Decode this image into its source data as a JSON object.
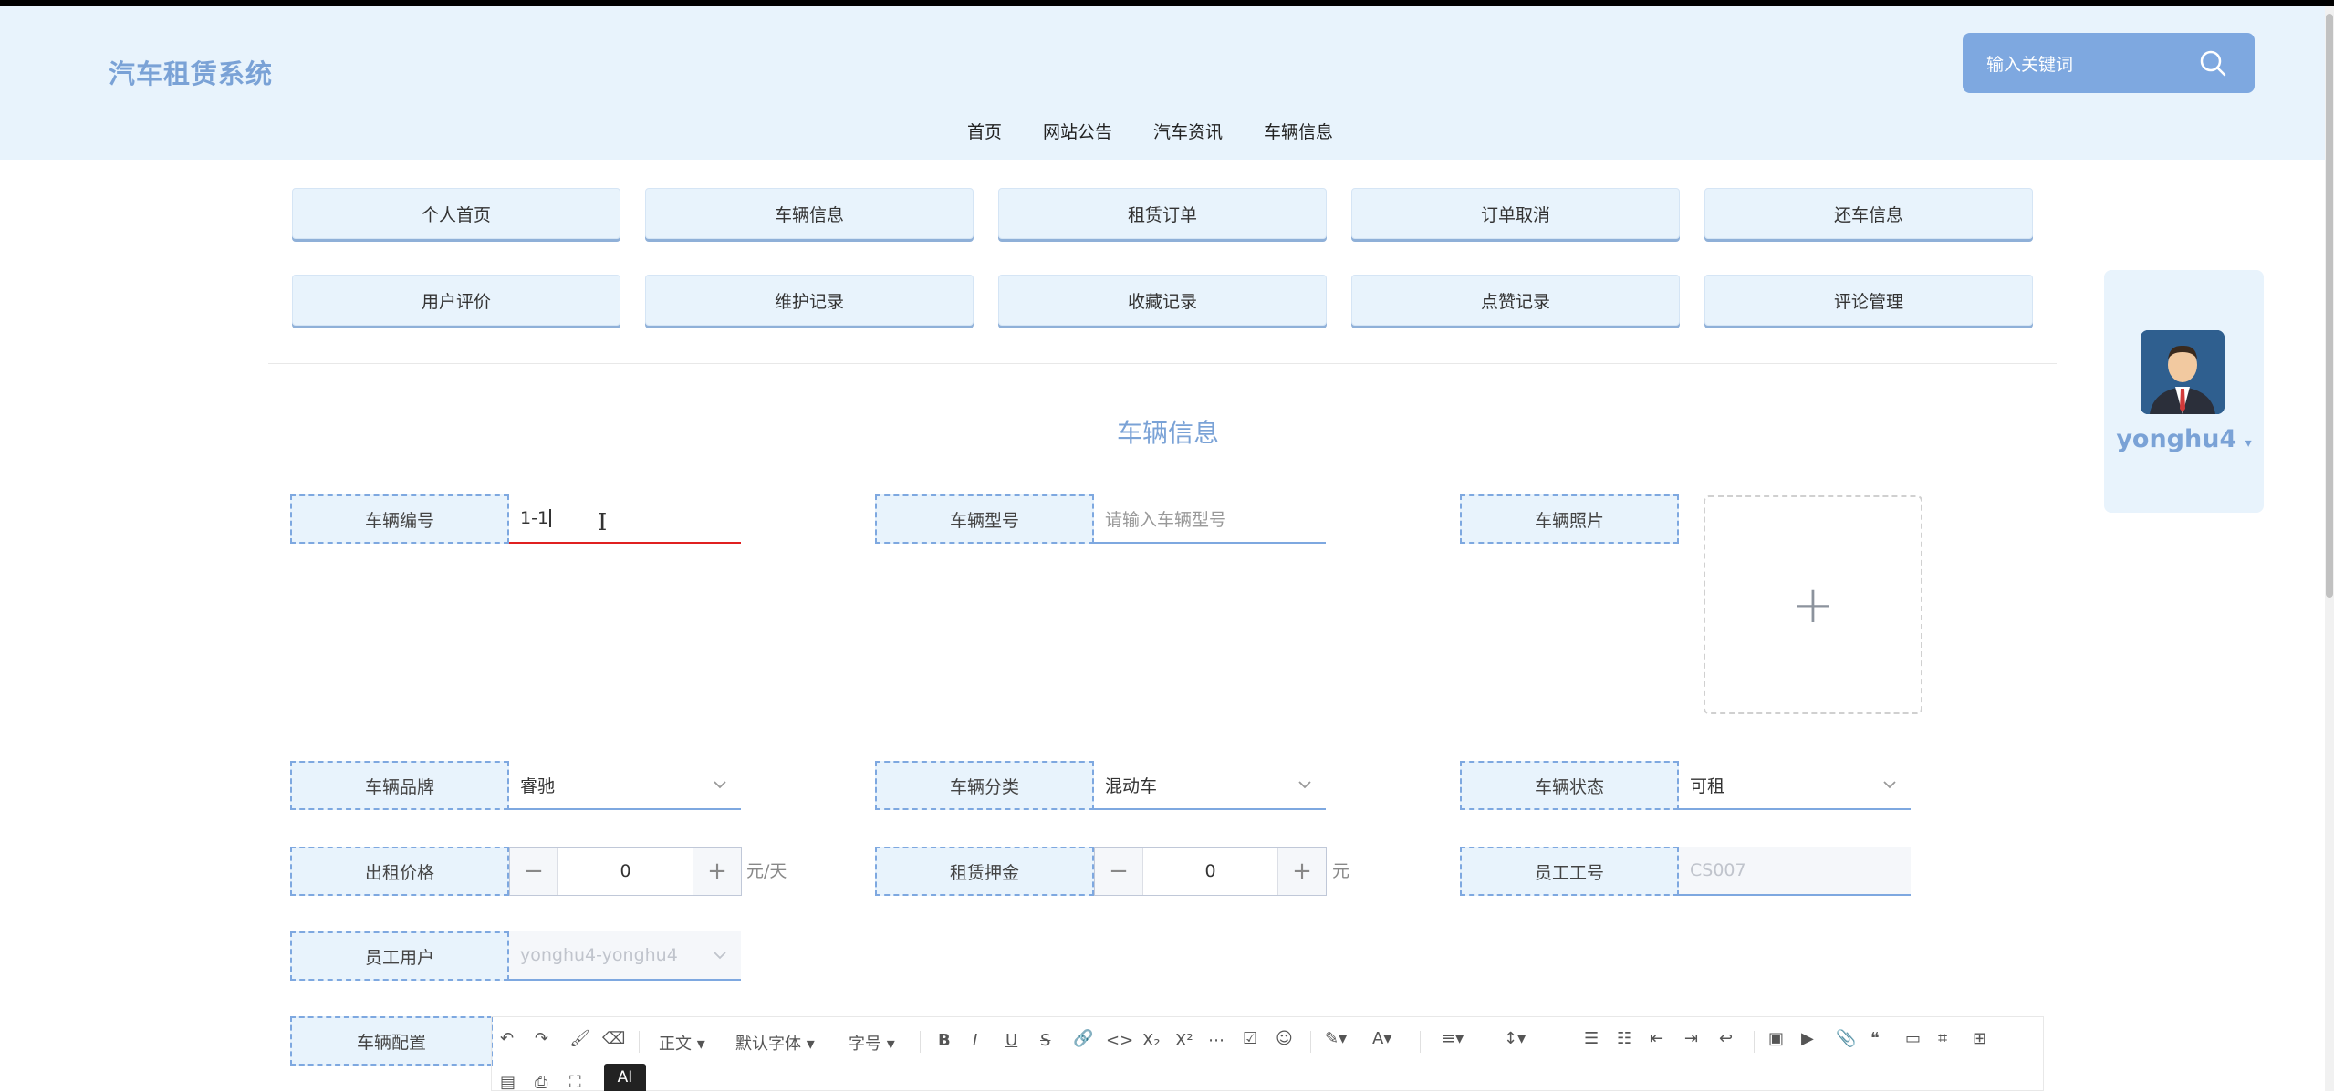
{
  "app": {
    "title": "汽车租赁系统"
  },
  "search": {
    "placeholder": "输入关键词",
    "icon": "search-icon"
  },
  "nav": [
    "首页",
    "网站公告",
    "汽车资讯",
    "车辆信息"
  ],
  "menu_row1": [
    "个人首页",
    "车辆信息",
    "租赁订单",
    "订单取消",
    "还车信息"
  ],
  "menu_row2": [
    "用户评价",
    "维护记录",
    "收藏记录",
    "点赞记录",
    "评论管理"
  ],
  "user": {
    "name": "yonghu4",
    "icon": "avatar"
  },
  "section_title": "车辆信息",
  "form": {
    "vehicle_no": {
      "label": "车辆编号",
      "value": "1-1"
    },
    "vehicle_model": {
      "label": "车辆型号",
      "placeholder": "请输入车辆型号"
    },
    "vehicle_photo": {
      "label": "车辆照片",
      "upload_icon": "+"
    },
    "brand": {
      "label": "车辆品牌",
      "value": "睿驰"
    },
    "category": {
      "label": "车辆分类",
      "value": "混动车"
    },
    "status": {
      "label": "车辆状态",
      "value": "可租"
    },
    "rent_price": {
      "label": "出租价格",
      "value": "0",
      "unit": "元/天"
    },
    "deposit": {
      "label": "租赁押金",
      "value": "0",
      "unit": "元"
    },
    "employee_no": {
      "label": "员工工号",
      "value": "CS007"
    },
    "employee_user": {
      "label": "员工用户",
      "value": "yonghu4-yonghu4"
    },
    "config": {
      "label": "车辆配置"
    }
  },
  "editor": {
    "para_label": "正文",
    "font_label": "默认字体",
    "size_label": "字号",
    "ai_label": "AI"
  },
  "colors": {
    "accent": "#7aa2d6",
    "header_bg": "#e8f3fc",
    "active_underline": "#e02020"
  }
}
